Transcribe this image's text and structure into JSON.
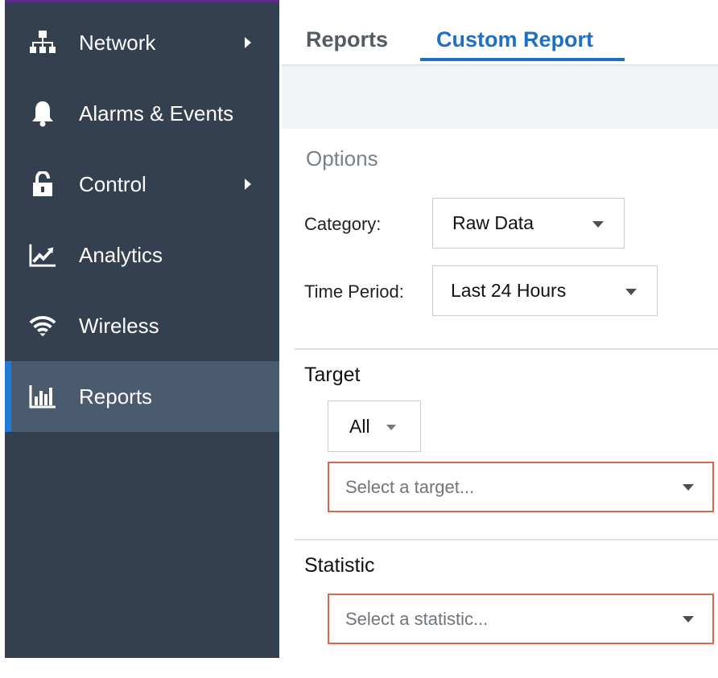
{
  "sidebar": {
    "items": [
      {
        "label": "Network",
        "icon": "network-icon",
        "has_submenu": true
      },
      {
        "label": "Alarms & Events",
        "icon": "bell-icon",
        "has_submenu": false
      },
      {
        "label": "Control",
        "icon": "unlock-icon",
        "has_submenu": true
      },
      {
        "label": "Analytics",
        "icon": "trend-chart-icon",
        "has_submenu": false
      },
      {
        "label": "Wireless",
        "icon": "wifi-icon",
        "has_submenu": false
      },
      {
        "label": "Reports",
        "icon": "bar-chart-icon",
        "has_submenu": false,
        "active": true
      }
    ]
  },
  "tabs": [
    {
      "label": "Reports",
      "active": false
    },
    {
      "label": "Custom Report",
      "active": true
    }
  ],
  "options": {
    "title": "Options",
    "category": {
      "label": "Category:",
      "value": "Raw Data"
    },
    "time_period": {
      "label": "Time Period:",
      "value": "Last 24 Hours"
    }
  },
  "target": {
    "title": "Target",
    "filter": {
      "value": "All"
    },
    "select": {
      "placeholder": "Select a target..."
    }
  },
  "statistic": {
    "title": "Statistic",
    "select": {
      "placeholder": "Select a statistic..."
    }
  },
  "colors": {
    "sidebar_bg": "#34404f",
    "active_item_bg": "#4a5a6f",
    "accent": "#1f6fc4",
    "error_border": "#d26a50"
  }
}
